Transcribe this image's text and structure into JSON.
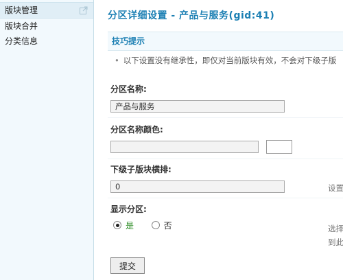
{
  "sidebar": {
    "items": [
      {
        "label": "版块管理",
        "active": true
      },
      {
        "label": "版块合并",
        "active": false
      },
      {
        "label": "分类信息",
        "active": false
      }
    ]
  },
  "page": {
    "title": "分区详细设置 - 产品与服务(gid:41)"
  },
  "tips": {
    "heading": "技巧提示",
    "text": "以下设置没有继承性，即仅对当前版块有效，不会对下级子版"
  },
  "form": {
    "name_label": "分区名称:",
    "name_value": "产品与服务",
    "color_label": "分区名称颜色:",
    "color_value": "",
    "subforum_label": "下级子版块横排:",
    "subforum_value": "0",
    "subforum_hint": "设置",
    "show_label": "显示分区:",
    "show_options": [
      {
        "label": "是",
        "checked": true
      },
      {
        "label": "否",
        "checked": false
      }
    ],
    "show_hint_line1": "选择",
    "show_hint_line2": "到此",
    "submit_label": "提交"
  },
  "colors": {
    "accent": "#1b7fb3",
    "sidebar_bg": "#f2f9fd",
    "yes_green": "#2a8a22"
  }
}
